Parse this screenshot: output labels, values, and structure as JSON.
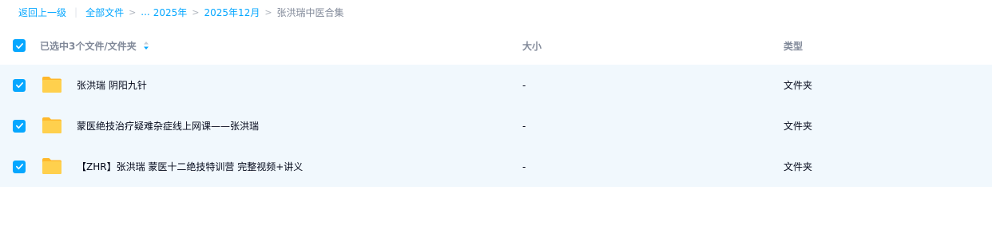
{
  "breadcrumb": {
    "back": "返回上一级",
    "all_files": "全部文件",
    "ellipsis": "...",
    "crumbs": [
      "2025年",
      "2025年12月"
    ],
    "current": "张洪瑞中医合集"
  },
  "header": {
    "selected_label": "已选中3个文件/文件夹",
    "size_label": "大小",
    "type_label": "类型"
  },
  "rows": [
    {
      "name": "张洪瑞  阴阳九针",
      "size": "-",
      "type": "文件夹",
      "checked": true
    },
    {
      "name": "蒙医绝技治疗疑难杂症线上网课——张洪瑞",
      "size": "-",
      "type": "文件夹",
      "checked": true
    },
    {
      "name": "【ZHR】张洪瑞 蒙医十二绝技特训营 完整视频+讲义",
      "size": "-",
      "type": "文件夹",
      "checked": true
    }
  ],
  "colors": {
    "accent": "#06a7ff",
    "row_selected_bg": "#f1f8fd",
    "folder": "#ffc63a"
  },
  "icons": {
    "checkbox": "check-icon",
    "sort": "sort-icon",
    "folder": "folder-icon"
  }
}
